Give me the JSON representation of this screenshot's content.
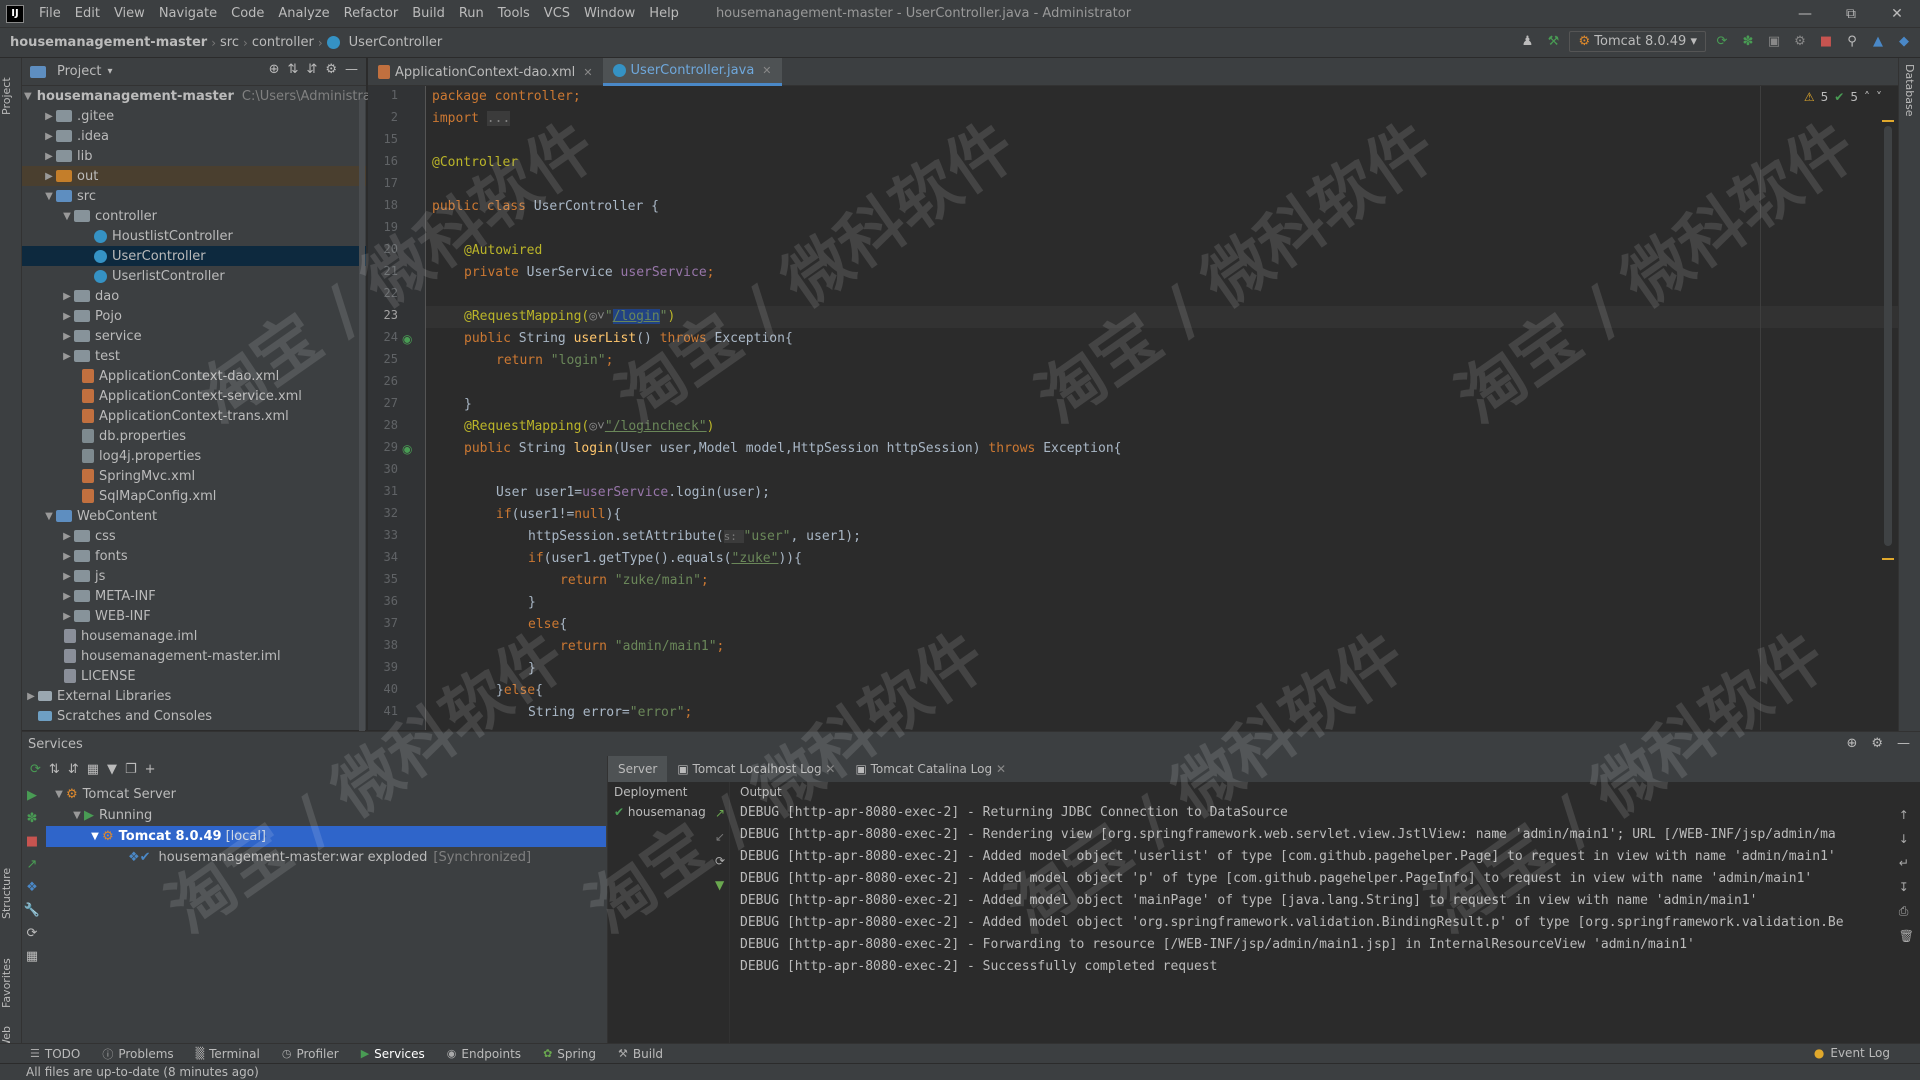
{
  "menu": {
    "items": [
      "File",
      "Edit",
      "View",
      "Navigate",
      "Code",
      "Analyze",
      "Refactor",
      "Build",
      "Run",
      "Tools",
      "VCS",
      "Window",
      "Help"
    ],
    "window_title": "housemanagement-master - UserController.java - Administrator"
  },
  "nav": {
    "project": "housemanagement-master",
    "crumbs": [
      "src",
      "controller",
      "UserController"
    ],
    "run_config": "Tomcat 8.0.49"
  },
  "side_tabs": {
    "project": "Project",
    "structure": "Structure",
    "favorites": "Favorites",
    "web": "Web",
    "database": "Database"
  },
  "project_panel": {
    "title": "Project",
    "tree": [
      {
        "label": "housemanagement-master",
        "hint": "C:\\Users\\Administrato"
      },
      {
        "label": ".gitee"
      },
      {
        "label": ".idea"
      },
      {
        "label": "lib"
      },
      {
        "label": "out"
      },
      {
        "label": "src"
      },
      {
        "label": "controller"
      },
      {
        "label": "HoustlistController"
      },
      {
        "label": "UserController"
      },
      {
        "label": "UserlistController"
      },
      {
        "label": "dao"
      },
      {
        "label": "Pojo"
      },
      {
        "label": "service"
      },
      {
        "label": "test"
      },
      {
        "label": "ApplicationContext-dao.xml"
      },
      {
        "label": "ApplicationContext-service.xml"
      },
      {
        "label": "ApplicationContext-trans.xml"
      },
      {
        "label": "db.properties"
      },
      {
        "label": "log4j.properties"
      },
      {
        "label": "SpringMvc.xml"
      },
      {
        "label": "SqlMapConfig.xml"
      },
      {
        "label": "WebContent"
      },
      {
        "label": "css"
      },
      {
        "label": "fonts"
      },
      {
        "label": "js"
      },
      {
        "label": "META-INF"
      },
      {
        "label": "WEB-INF"
      },
      {
        "label": "housemanage.iml"
      },
      {
        "label": "housemanagement-master.iml"
      },
      {
        "label": "LICENSE"
      },
      {
        "label": "External Libraries"
      },
      {
        "label": "Scratches and Consoles"
      }
    ]
  },
  "editor": {
    "tabs": [
      "ApplicationContext-dao.xml",
      "UserController.java"
    ],
    "inspections": {
      "warnings": "5",
      "ok": "5"
    },
    "line_numbers": [
      "1",
      "2",
      "15",
      "16",
      "17",
      "18",
      "19",
      "20",
      "21",
      "22",
      "23",
      "24",
      "25",
      "26",
      "27",
      "28",
      "29",
      "30",
      "31",
      "32",
      "33",
      "34",
      "35",
      "36",
      "37",
      "38",
      "39",
      "40",
      "41"
    ],
    "code": {
      "l1": "package controller;",
      "l2a": "import ",
      "l2b": "...",
      "l16": "@Controller",
      "l18a": "public class ",
      "l18b": "UserController {",
      "l20": "@Autowired",
      "l21a": "private ",
      "l21b": "UserService ",
      "l21c": "userService",
      "l21d": ";",
      "l23a": "@RequestMapping(",
      "l23b": "\"",
      "l23c": "/login",
      "l23d": "\"",
      "l23e": ")",
      "l24a": "public ",
      "l24b": "String ",
      "l24c": "userList",
      "l24d": "() ",
      "l24e": "throws ",
      "l24f": "Exception{",
      "l25a": "return ",
      "l25b": "\"login\"",
      "l25c": ";",
      "l27": "}",
      "l28a": "@RequestMapping(",
      "l28b": "\"/logincheck\"",
      "l28c": ")",
      "l29a": "public ",
      "l29b": "String ",
      "l29c": "login",
      "l29d": "(User user,Model model,HttpSession httpSession) ",
      "l29e": "throws ",
      "l29f": "Exception{",
      "l31a": "User user1=",
      "l31b": "userService",
      "l31c": ".login(user);",
      "l32a": "if",
      "l32b": "(user1!=",
      "l32c": "null",
      "l32d": "){",
      "l33a": "httpSession.setAttribute(",
      "l33b": "s: ",
      "l33c": "\"user\"",
      "l33d": ", user1);",
      "l34a": "if",
      "l34b": "(user1.getType().equals(",
      "l34c": "\"zuke\"",
      "l34d": ")){",
      "l35a": "return ",
      "l35b": "\"zuke/main\"",
      "l35c": ";",
      "l36": "}",
      "l37a": "else",
      "l37b": "{",
      "l38a": "return ",
      "l38b": "\"admin/main1\"",
      "l38c": ";",
      "l39": "}",
      "l40a": "}",
      "l40b": "else",
      "l40c": "{",
      "l41a": "String error=",
      "l41b": "\"error\"",
      "l41c": ";"
    }
  },
  "services": {
    "title": "Services",
    "tree": {
      "server": "Tomcat Server",
      "running": "Running",
      "instance": "Tomcat 8.0.49",
      "instance_tag": "[local]",
      "artifact": "housemanagement-master:war exploded",
      "artifact_state": "[Synchronized]"
    },
    "tabs": [
      "Server",
      "Tomcat Localhost Log",
      "Tomcat Catalina Log"
    ],
    "deployment_header": "Deployment",
    "output_header": "Output",
    "deployment_item": "housemanage",
    "log": [
      "DEBUG [http-apr-8080-exec-2] - Returning JDBC Connection to DataSource",
      "DEBUG [http-apr-8080-exec-2] - Rendering view [org.springframework.web.servlet.view.JstlView: name 'admin/main1'; URL [/WEB-INF/jsp/admin/ma",
      "DEBUG [http-apr-8080-exec-2] - Added model object 'userlist' of type [com.github.pagehelper.Page] to request in view with name 'admin/main1'",
      "DEBUG [http-apr-8080-exec-2] - Added model object 'p' of type [com.github.pagehelper.PageInfo] to request in view with name 'admin/main1'",
      "DEBUG [http-apr-8080-exec-2] - Added model object 'mainPage' of type [java.lang.String] to request in view with name 'admin/main1'",
      "DEBUG [http-apr-8080-exec-2] - Added model object 'org.springframework.validation.BindingResult.p' of type [org.springframework.validation.Be",
      "DEBUG [http-apr-8080-exec-2] - Forwarding to resource [/WEB-INF/jsp/admin/main1.jsp] in InternalResourceView 'admin/main1'",
      "DEBUG [http-apr-8080-exec-2] - Successfully completed request"
    ]
  },
  "bottom_tabs": [
    "TODO",
    "Problems",
    "Terminal",
    "Profiler",
    "Services",
    "Endpoints",
    "Spring",
    "Build"
  ],
  "event_log": "Event Log",
  "status": "All files are up-to-date (8 minutes ago)",
  "watermark": "淘宝 / 微科软件",
  "colors": {
    "accent": "#4a88c7",
    "selection": "#2f65ca",
    "keyword": "#cc7832",
    "string": "#6a8759",
    "annotation": "#bbb529"
  }
}
